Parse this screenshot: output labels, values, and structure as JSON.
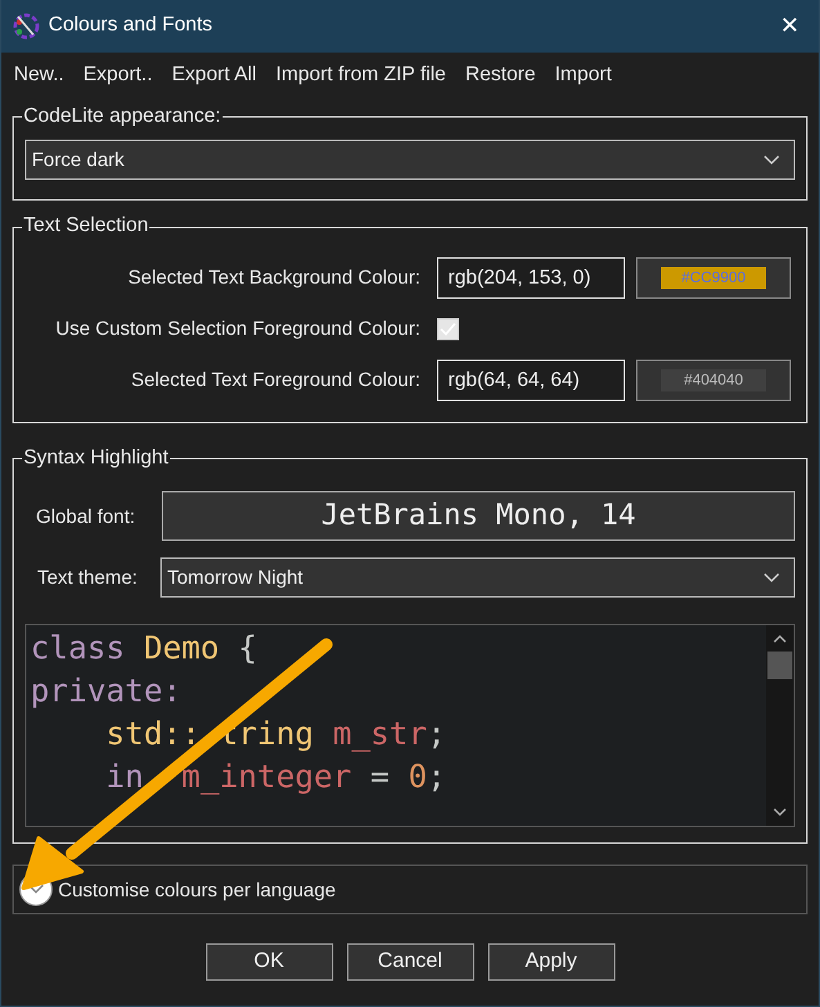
{
  "window": {
    "title": "Colours and Fonts",
    "close": "✕"
  },
  "menu": [
    "New..",
    "Export..",
    "Export All",
    "Import from ZIP file",
    "Restore",
    "Import"
  ],
  "appearance": {
    "legend": "CodeLite appearance:",
    "value": "Force dark"
  },
  "text_selection": {
    "legend": "Text Selection",
    "rows": [
      {
        "kind": "colour",
        "label": "Selected Text Background Colour:",
        "value": "rgb(204, 153, 0)",
        "swatch": "#CC9900",
        "color": "#cc9900"
      },
      {
        "kind": "checkbox",
        "label": "Use Custom Selection Foreground Colour:",
        "checked": true
      },
      {
        "kind": "colour",
        "label": "Selected Text Foreground Colour:",
        "value": "rgb(64, 64, 64)",
        "swatch": "#404040",
        "color": "#404040"
      }
    ]
  },
  "syntax": {
    "legend": "Syntax Highlight",
    "font_label": "Global font:",
    "font": "JetBrains Mono, 14",
    "theme_label": "Text theme:",
    "theme": "Tomorrow Night",
    "code": [
      [
        {
          "text": "class",
          "kind": "keyword"
        },
        {
          "text": " Demo",
          "kind": "type"
        },
        {
          "text": " {",
          "kind": "plain"
        }
      ],
      [
        {
          "text": "private:",
          "kind": "keyword"
        }
      ],
      [
        {
          "text": "    std::",
          "kind": "type"
        },
        {
          "text": " tring",
          "kind": "type"
        },
        {
          "text": " m_str",
          "kind": "identifier"
        },
        {
          "text": ";",
          "kind": "plain"
        }
      ],
      [
        {
          "text": "    in",
          "kind": "keyword"
        },
        {
          "text": "  m_integer",
          "kind": "identifier"
        },
        {
          "text": " = ",
          "kind": "plain"
        },
        {
          "text": "0",
          "kind": "number"
        },
        {
          "text": ";",
          "kind": "plain"
        }
      ]
    ]
  },
  "per_language": {
    "label": "Customise colours per language",
    "expanded": false
  },
  "buttons": [
    "OK",
    "Cancel",
    "Apply"
  ]
}
